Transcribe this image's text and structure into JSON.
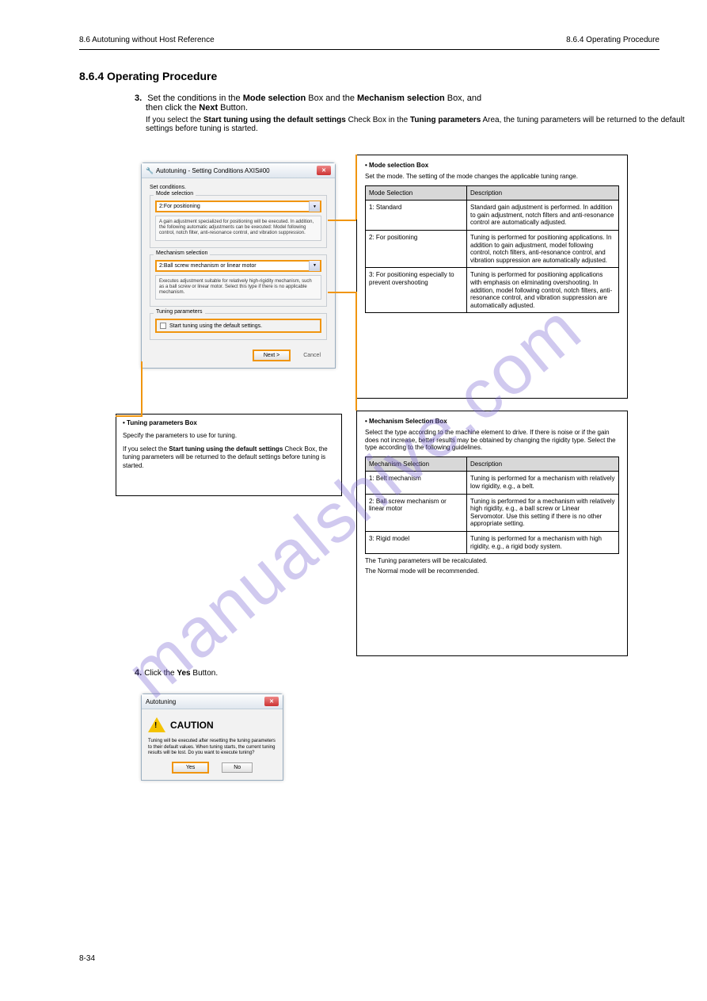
{
  "header": {
    "section": "8.6 Autotuning without Host Reference",
    "subsection": "8.6.4 Operating Procedure"
  },
  "watermark": "manualshive.com",
  "section_title": "8.6.4  Operating Procedure",
  "step3": {
    "num": "3.",
    "line1": "Set the conditions in the ",
    "bold1": "Mode selection",
    "mid1": " Box and the ",
    "bold2": "Mechanism selection",
    "mid2": " Box, and",
    "line2": "then click the ",
    "bold3": "Next",
    "tail": " Button."
  },
  "dialog1": {
    "title": "Autotuning - Setting Conditions AXIS#00",
    "setcond": "Set conditions.",
    "mode_legend": "Mode selection",
    "mode_value": "2:For positioning",
    "mode_desc": "A gain adjustment specialized for positioning will be executed. In addition, the following automatic adjustments can be executed: Model following control, notch filter, anti-resonance control, and vibration suppression.",
    "mech_legend": "Mechanism selection",
    "mech_value": "2:Ball screw mechanism or linear motor",
    "mech_desc": "Executes adjustment suitable for relatively high-rigidity mechanism, such as a ball screw or linear motor. Select this type if there is no applicable mechanism.",
    "tuning_legend": "Tuning parameters",
    "tuning_label": "Start tuning using the default settings.",
    "next": "Next >",
    "cancel": "Cancel"
  },
  "infobox1": {
    "head": "• Mode selection Box",
    "sub": "Set the mode. The setting of the mode changes the applicable tuning range.",
    "th1": "Mode Selection",
    "th2": "Description",
    "r1c1": "1: Standard",
    "r1c2": "Standard gain adjustment is performed. In addition to gain adjustment, notch filters and anti-resonance control are automatically adjusted.",
    "r2c1": "2: For positioning",
    "r2c2": "Tuning is performed for positioning applications. In addition to gain adjustment, model following control, notch filters, anti-resonance control, and vibration suppression are automatically adjusted.",
    "r3c1": "3: For positioning especially to prevent overshooting",
    "r3c2": "Tuning is performed for positioning applications with emphasis on eliminating overshooting. In addition, model following control, notch filters, anti-resonance control, and vibration suppression are automatically adjusted."
  },
  "infobox2": {
    "head": "• Mechanism Selection Box",
    "sub": "Select the type according to the machine element to drive. If there is noise or if the gain does not increase, better results may be obtained by changing the rigidity type. Select the type according to the following guidelines.",
    "th1": "Mechanism Selection",
    "th2": "Description",
    "r1c1": "1: Belt mechanism",
    "r1c2": "Tuning is performed for a mechanism with relatively low rigidity, e.g., a belt.",
    "r2c1": "2: Ball screw mechanism or linear motor",
    "r2c2": "Tuning is performed for a mechanism with relatively high rigidity, e.g., a ball screw or Linear Servomotor. Use this setting if there is no other appropriate setting.",
    "r3c1": "3: Rigid model",
    "r3c2": "Tuning is performed for a mechanism with high rigidity, e.g., a rigid body system.",
    "recline": "The Tuning parameters will be recalculated.",
    "reclast": "The Normal mode will be recommended."
  },
  "left_callout": {
    "head": "• Tuning parameters Box",
    "p1": "Specify the parameters to use for tuning.",
    "p2a": "If you select the ",
    "p2b": "Start tuning using the default settings",
    "p2c": " Check Box, the tuning parameters will be returned to the default settings before tuning is started."
  },
  "step4": {
    "num": "4.",
    "l1a": "Click the ",
    "l1b": "Yes",
    "l1c": " Button."
  },
  "dialog2": {
    "title": "Autotuning",
    "caution": "CAUTION",
    "msg": "Tuning will be executed after resetting the tuning parameters to their default values.\nWhen tuning starts, the current tuning results will be lost.\nDo you want to execute tuning?",
    "yes": "Yes",
    "no": "No"
  },
  "footer": "8-34"
}
